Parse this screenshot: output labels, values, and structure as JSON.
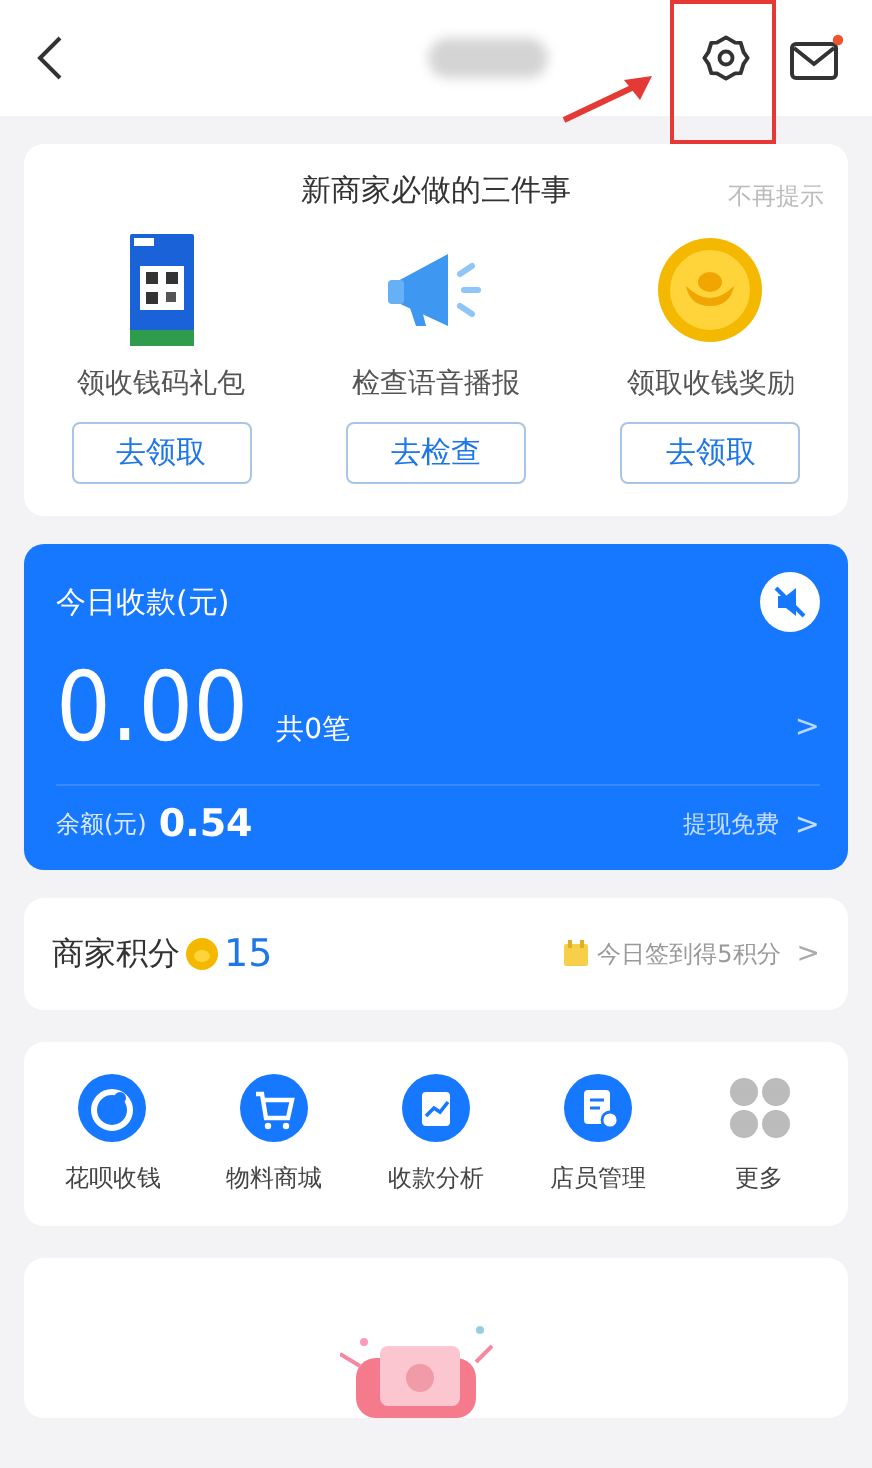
{
  "header": {
    "unread_mail": true,
    "annotation": true
  },
  "tasks_card": {
    "title": "新商家必做的三件事",
    "dismiss": "不再提示",
    "tasks": [
      {
        "kind": "qr",
        "label": "领收钱码礼包",
        "button": "去领取"
      },
      {
        "kind": "speaker",
        "label": "检查语音播报",
        "button": "去检查"
      },
      {
        "kind": "coin",
        "label": "领取收钱奖励",
        "button": "去领取"
      }
    ]
  },
  "income_card": {
    "title": "今日收款(元)",
    "muted": true,
    "amount": "0.00",
    "count": "共0笔",
    "chevron": ">",
    "balance_label": "余额(元)",
    "balance": "0.54",
    "withdraw": "提现免费",
    "withdraw_chevron": ">"
  },
  "points": {
    "label": "商家积分",
    "value": "15",
    "checkin": "今日签到得5积分",
    "chevron": ">"
  },
  "tools": [
    {
      "kind": "huabei",
      "label": "花呗收钱"
    },
    {
      "kind": "cart",
      "label": "物料商城"
    },
    {
      "kind": "chart",
      "label": "收款分析"
    },
    {
      "kind": "staff",
      "label": "店员管理"
    },
    {
      "kind": "more",
      "label": "更多"
    }
  ]
}
